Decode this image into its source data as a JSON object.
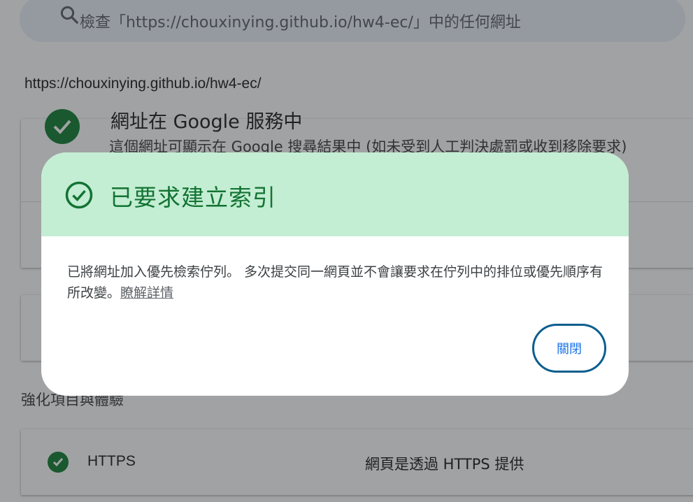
{
  "search": {
    "placeholder": "檢查「https://chouxinying.github.io/hw4-ec/」中的任何網址"
  },
  "inspected_url": "https://chouxinying.github.io/hw4-ec/",
  "status_card": {
    "title": "網址在 Google 服務中",
    "description": "這個網址可顯示在 Google 搜尋結果中 (如未受到人工判決處罰或收到移除要求)"
  },
  "enhancements": {
    "heading": "強化項目與體驗",
    "items": [
      {
        "name": "HTTPS",
        "value": "網頁是透過 HTTPS 提供"
      }
    ]
  },
  "dialog": {
    "title": "已要求建立索引",
    "message": "已將網址加入優先檢索佇列。 多次提交同一網頁並不會讓要求在佇列中的排位或優先順序有所改變。",
    "learn_more": "瞭解詳情",
    "close_label": "關閉"
  },
  "colors": {
    "success_green": "#188038",
    "dialog_header_bg": "#c3eed3",
    "dialog_title": "#137333",
    "close_border": "#0b5e8e",
    "close_text": "#1a73e8"
  },
  "icons": {
    "search": "search-icon",
    "check": "check-circle-icon",
    "dialog_status": "check-circle-outline-icon"
  }
}
